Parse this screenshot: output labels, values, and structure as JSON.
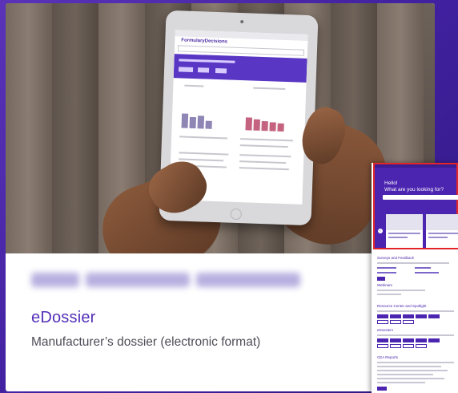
{
  "card": {
    "blurred_heading": "",
    "title": "eDossier",
    "subtitle": "Manufacturer’s dossier (electronic format)"
  },
  "tablet_screen": {
    "logo": "FormularyDecisions"
  },
  "thumbnail": {
    "hello": "Hello!",
    "question": "What are you looking for?",
    "sections": [
      "Surveys and Feedback",
      "Webinars",
      "Resource Center and Spotlight",
      "eDossiers",
      "CEA Reports"
    ]
  },
  "colors": {
    "brand_purple": "#4b24b0",
    "title_purple": "#5430b8",
    "highlight_red": "#e0262b"
  }
}
